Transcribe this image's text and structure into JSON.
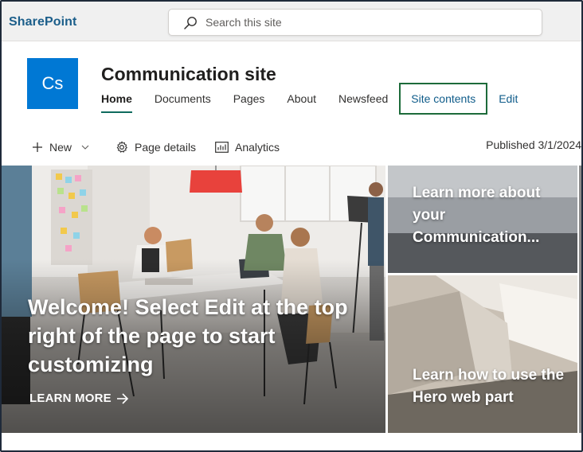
{
  "suitebar": {
    "brand": "SharePoint",
    "search_placeholder": "Search this site"
  },
  "site": {
    "logo_text": "Cs",
    "title": "Communication site",
    "logo_color": "#0078d4"
  },
  "nav": {
    "items": [
      {
        "label": "Home",
        "active": true
      },
      {
        "label": "Documents"
      },
      {
        "label": "Pages"
      },
      {
        "label": "About"
      },
      {
        "label": "Newsfeed"
      },
      {
        "label": "Site contents",
        "focused": true
      },
      {
        "label": "Edit"
      }
    ]
  },
  "commandbar": {
    "new_label": "New",
    "page_details_label": "Page details",
    "analytics_label": "Analytics",
    "published": "Published 3/1/2024"
  },
  "hero": {
    "main": {
      "headline": "Welcome! Select Edit at the top right of the page to start customizing",
      "link": "LEARN MORE"
    },
    "top_right": {
      "text": "Learn more about your Communication..."
    },
    "bottom_right": {
      "text": "Learn how to use the Hero web part"
    }
  }
}
